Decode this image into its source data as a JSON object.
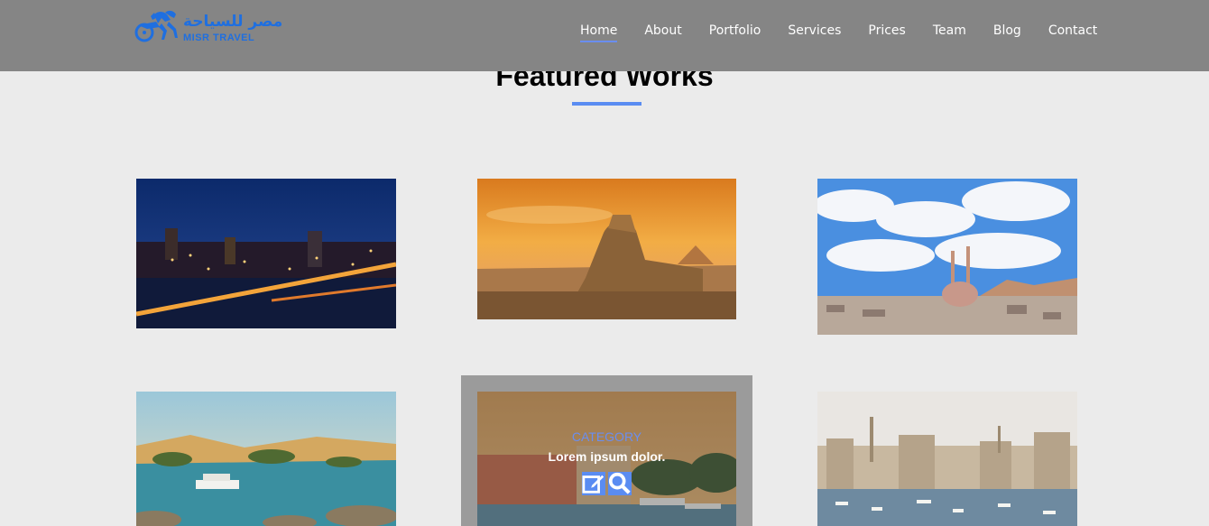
{
  "brand": {
    "arabic_name": "مصر للسياحة",
    "latin_name": "MISR TRAVEL",
    "color": "#1f6fe0"
  },
  "nav": {
    "items": [
      {
        "label": "Home",
        "active": true
      },
      {
        "label": "About"
      },
      {
        "label": "Portfolio"
      },
      {
        "label": "Services"
      },
      {
        "label": "Prices"
      },
      {
        "label": "Team"
      },
      {
        "label": "Blog"
      },
      {
        "label": "Contact"
      }
    ]
  },
  "section": {
    "title": "Featured Works",
    "accent": "#5a8cf2"
  },
  "works": [
    {
      "scene": "cairo-night"
    },
    {
      "scene": "sphinx-pyramid"
    },
    {
      "scene": "mosque-skyline"
    },
    {
      "scene": "aswan-nile"
    },
    {
      "scene": "harbor-town",
      "category": "CATEGORY",
      "title": "Lorem ipsum dolor.",
      "icons": [
        "edit-icon",
        "search-icon"
      ]
    },
    {
      "scene": "alexandria-harbor"
    }
  ]
}
